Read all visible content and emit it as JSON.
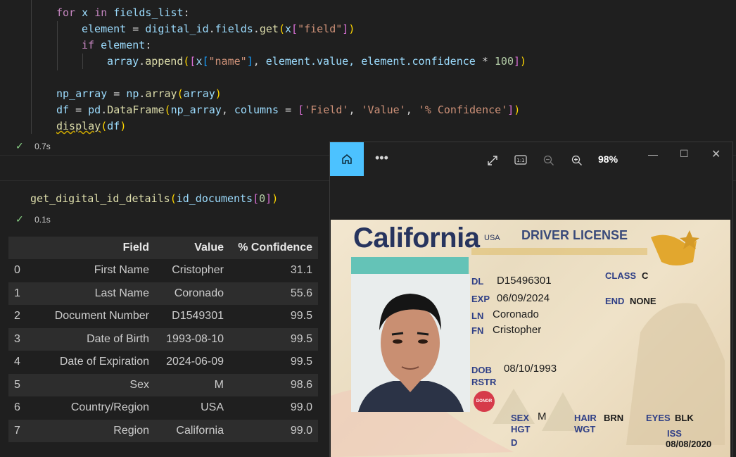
{
  "code_cell_1": {
    "lines": {
      "l1": {
        "kw": "for",
        "v1": "x",
        "kw2": "in",
        "v2": "fields_list",
        "p": ":"
      },
      "l2": {
        "v": "element",
        "eq": " = ",
        "obj": "digital_id",
        "dot": ".",
        "v2": "fields",
        "fn": "get",
        "a": "x",
        "s": "\"field\""
      },
      "l3": {
        "kw": "if",
        "v": "element",
        "p": ":"
      },
      "l4": {
        "v": "array",
        "fn": "append",
        "a": "x",
        "s": "\"name\"",
        "c": "element.value, element.confidence",
        "op": " * ",
        "n": "100"
      },
      "l5": {
        "v": "np_array",
        "eq": " = ",
        "mod": "np",
        "fn": "array",
        "a": "array"
      },
      "l6": {
        "v": "df",
        "eq": " = ",
        "mod": "pd",
        "fn": "DataFrame",
        "a": "np_array",
        "kwarg": "columns",
        "s1": "'Field'",
        "s2": "'Value'",
        "s3": "'% Confidence'"
      },
      "l7": {
        "fn": "display",
        "a": "df"
      }
    },
    "status_time": "0.7s"
  },
  "code_cell_2": {
    "code": {
      "fn": "get_digital_id_details",
      "a": "id_documents",
      "n": "0"
    },
    "status_time": "0.1s"
  },
  "dataframe": {
    "columns": [
      "Field",
      "Value",
      "% Confidence"
    ],
    "rows": [
      {
        "i": "0",
        "field": "First Name",
        "value": "Cristopher",
        "conf": "31.1"
      },
      {
        "i": "1",
        "field": "Last Name",
        "value": "Coronado",
        "conf": "55.6"
      },
      {
        "i": "2",
        "field": "Document Number",
        "value": "D1549301",
        "conf": "99.5"
      },
      {
        "i": "3",
        "field": "Date of Birth",
        "value": "1993-08-10",
        "conf": "99.5"
      },
      {
        "i": "4",
        "field": "Date of Expiration",
        "value": "2024-06-09",
        "conf": "99.5"
      },
      {
        "i": "5",
        "field": "Sex",
        "value": "M",
        "conf": "98.6"
      },
      {
        "i": "6",
        "field": "Country/Region",
        "value": "USA",
        "conf": "99.0"
      },
      {
        "i": "7",
        "field": "Region",
        "value": "California",
        "conf": "99.0"
      }
    ]
  },
  "viewer": {
    "zoom": "98%",
    "card": {
      "state": "California",
      "country": "USA",
      "doc_type": "DRIVER LICENSE",
      "dl_label": "DL",
      "dl_value": "D15496301",
      "exp_label": "EXP",
      "exp_value": "06/09/2024",
      "ln_label": "LN",
      "ln_value": "Coronado",
      "fn_label": "FN",
      "fn_value": "Cristopher",
      "class_label": "CLASS",
      "class_value": "C",
      "end_label": "END",
      "end_value": "NONE",
      "dob_label": "DOB",
      "dob_value": "08/10/1993",
      "rstr_label": "RSTR",
      "donor_label": "DONOR",
      "sex_label": "SEX",
      "sex_value": "M",
      "hgt_label": "HGT",
      "hair_label": "HAIR",
      "hair_value": "BRN",
      "wgt_label": "WGT",
      "eyes_label": "EYES",
      "eyes_value": "BLK",
      "iss_label": "ISS",
      "iss_value": "08/08/2020",
      "dd_label": "D"
    }
  },
  "colors": {
    "accent": "#4cc2ff",
    "check": "#89d185",
    "keyword": "#c586c0",
    "string": "#ce9178"
  }
}
